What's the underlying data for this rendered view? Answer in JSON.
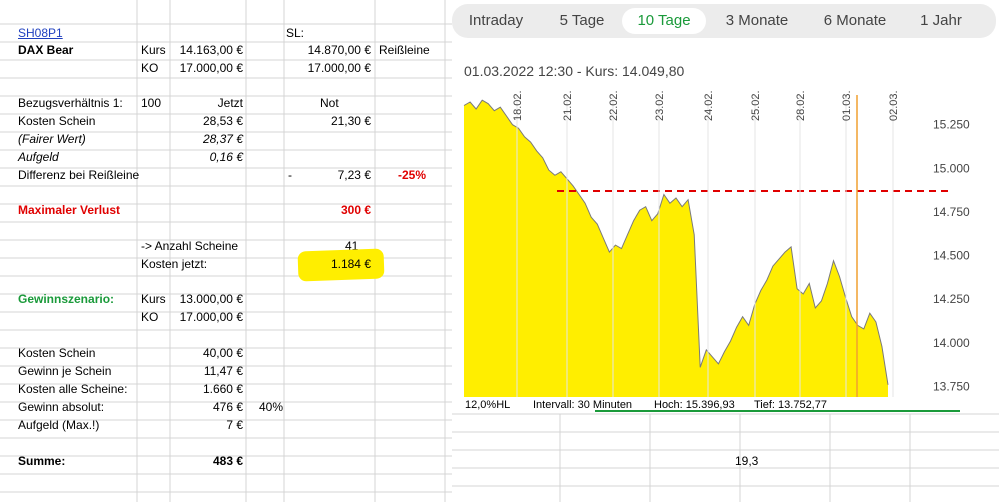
{
  "spreadsheet": {
    "ticker": "SH08P1",
    "sl_label": "SL:",
    "product": "DAX Bear",
    "kurs_label": "Kurs",
    "kurs_value": "14.163,00 €",
    "sl_kurs_value": "14.870,00 €",
    "reissleine": "Reißleine",
    "ko_label": "KO",
    "ko_value": "17.000,00 €",
    "sl_ko_value": "17.000,00 €",
    "bezug_label": "Bezugsverhältnis 1:",
    "bezug_value": "100",
    "jetzt_label": "Jetzt",
    "not_label": "Not",
    "kosten_schein_label": "Kosten Schein",
    "kosten_schein_value": "28,53 €",
    "kosten_schein_not": "21,30 €",
    "fairer_wert_label": "(Fairer Wert)",
    "fairer_wert_value": "28,37 €",
    "aufgeld_label": "Aufgeld",
    "aufgeld_value": "0,16 €",
    "differenz_label": "Differenz bei Reißleine",
    "differenz_dash": "-",
    "differenz_value": "7,23 €",
    "differenz_pct": "-25%",
    "max_verlust_label": "Maximaler Verlust",
    "max_verlust_value": "300 €",
    "anzahl_label": "-> Anzahl Scheine",
    "anzahl_value": "41",
    "kosten_jetzt_label": "Kosten jetzt:",
    "kosten_jetzt_value": "1.184 €",
    "gewinn_label": "Gewinnszenario:",
    "g_kurs_label": "Kurs",
    "g_kurs_value": "13.000,00 €",
    "g_ko_label": "KO",
    "g_ko_value": "17.000,00 €",
    "g_kosten_schein_label": "Kosten Schein",
    "g_kosten_schein_value": "40,00 €",
    "g_gewinn_je_label": "Gewinn je Schein",
    "g_gewinn_je_value": "11,47 €",
    "g_kosten_alle_label": "Kosten alle Scheine:",
    "g_kosten_alle_value": "1.660 €",
    "g_gewinn_abs_label": "Gewinn absolut:",
    "g_gewinn_abs_value": "476 €",
    "g_gewinn_pct": "40%",
    "g_aufgeld_label": "Aufgeld (Max.!)",
    "g_aufgeld_value": "7 €",
    "summe_label": "Summe:",
    "summe_value": "483 €",
    "extra_value": "19,3"
  },
  "tabs": [
    "Intraday",
    "5 Tage",
    "10 Tage",
    "3 Monate",
    "6 Monate",
    "1 Jahr"
  ],
  "active_tab": "10 Tage",
  "chart_header": "01.03.2022 12:30  -  Kurs: 14.049,80",
  "stats": {
    "hl": "12,0%HL",
    "intervall": "Intervall: 30 Minuten",
    "hoch": "Hoch: 15.396,93",
    "tief": "Tief: 13.752,77"
  },
  "colors": {
    "area_fill": "#ffee00",
    "line": "#7a7a7a",
    "sl_line": "#e00000",
    "marker": "#f0a030",
    "highlight": "#ffee00",
    "accent_green": "#1a9a3a"
  },
  "chart_data": {
    "type": "area",
    "x_labels": [
      "18.02.",
      "21.02.",
      "22.02.",
      "23.02.",
      "24.02.",
      "25.02.",
      "28.02.",
      "01.03.",
      "02.03."
    ],
    "y_ticks": [
      "15.250",
      "15.000",
      "14.750",
      "14.500",
      "14.250",
      "14.000",
      "13.750"
    ],
    "y_tick_values": [
      15250,
      15000,
      14750,
      14500,
      14250,
      14000,
      13750
    ],
    "ylim": [
      13690,
      15420
    ],
    "reference_line": 14870,
    "series": [
      {
        "values": [
          15360,
          15380,
          15340,
          15390,
          15370,
          15330,
          15350,
          15300,
          15250,
          15230,
          15180,
          15150,
          15100,
          15060,
          14990,
          14960,
          14980,
          14940,
          14900,
          14850,
          14800,
          14720,
          14680,
          14600,
          14520,
          14560,
          14540,
          14620,
          14700,
          14760,
          14780,
          14700,
          14740,
          14850,
          14800,
          14830,
          14780,
          14820,
          14620,
          13860,
          13960,
          13920,
          13880,
          13950,
          14010,
          14090,
          14150,
          14100,
          14220,
          14300,
          14360,
          14440,
          14480,
          14520,
          14550,
          14310,
          14280,
          14340,
          14200,
          14240,
          14340,
          14470,
          14380,
          14260,
          14150,
          14100,
          14080,
          14170,
          14120,
          13980,
          13760
        ]
      }
    ]
  }
}
